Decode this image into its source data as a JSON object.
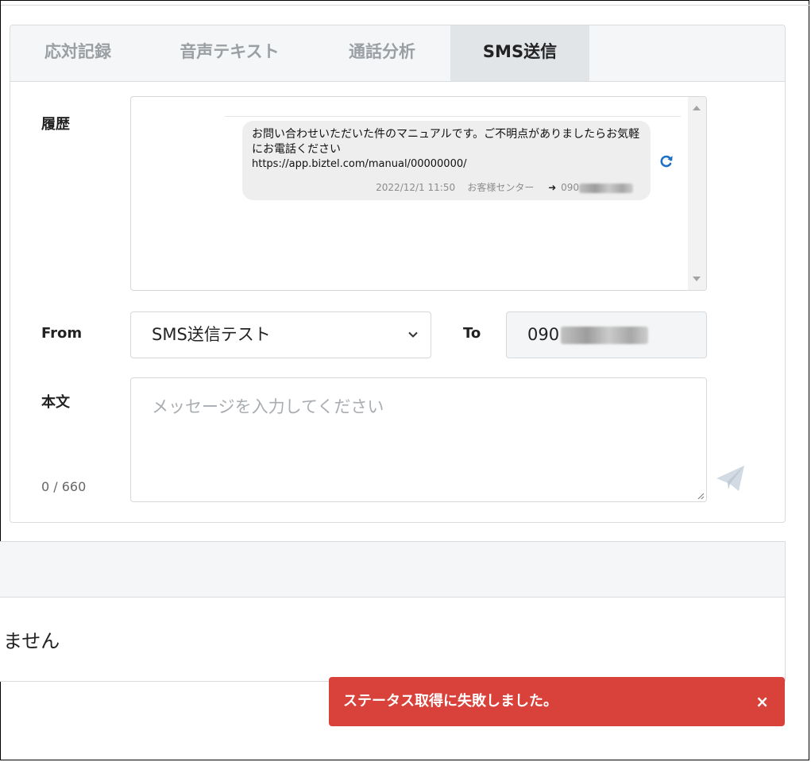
{
  "tabs": [
    {
      "label": "応対記録"
    },
    {
      "label": "音声テキスト"
    },
    {
      "label": "通話分析"
    },
    {
      "label": "SMS送信",
      "active": true
    }
  ],
  "history": {
    "label": "履歴",
    "message": {
      "text": "お問い合わせいただいた件のマニュアルです。ご不明点がありましたらお気軽にお電話ください",
      "url": "https://app.biztel.com/manual/00000000/",
      "datetime": "2022/12/1 11:50",
      "sender": "お客様センター",
      "to_prefix": "090"
    }
  },
  "from": {
    "label": "From",
    "selected": "SMS送信テスト"
  },
  "to": {
    "label": "To",
    "value_prefix": "090"
  },
  "body": {
    "label": "本文",
    "placeholder": "メッセージを入力してください",
    "counter": "0 / 660"
  },
  "lower_panel": {
    "text": "ません"
  },
  "toast": {
    "message": "ステータス取得に失敗しました。",
    "close": "×",
    "color": "#d9423a"
  },
  "icons": {
    "refresh": "refresh-icon",
    "send": "send-icon",
    "chevron": "chevron-down-icon"
  }
}
